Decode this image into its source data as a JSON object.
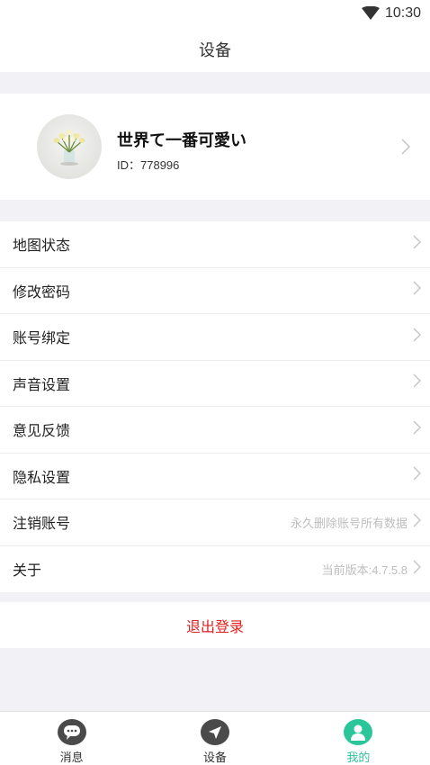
{
  "status_bar": {
    "time": "10:30",
    "wifi_icon": "wifi-icon"
  },
  "header": {
    "title": "设备"
  },
  "profile": {
    "name": "世界て一番可愛い",
    "id_text": "ID：778996",
    "avatar_icon": "flower-vase-avatar"
  },
  "menu": {
    "items": [
      {
        "label": "地图状态",
        "hint": ""
      },
      {
        "label": "修改密码",
        "hint": ""
      },
      {
        "label": "账号绑定",
        "hint": ""
      },
      {
        "label": "声音设置",
        "hint": ""
      },
      {
        "label": "意见反馈",
        "hint": ""
      },
      {
        "label": "隐私设置",
        "hint": ""
      },
      {
        "label": "注销账号",
        "hint": "永久删除账号所有数据"
      },
      {
        "label": "关于",
        "hint": "当前版本:4.7.5.8"
      }
    ]
  },
  "logout": {
    "label": "退出登录"
  },
  "tabs": [
    {
      "label": "消息",
      "icon": "message-icon",
      "active": false
    },
    {
      "label": "设备",
      "icon": "navigation-icon",
      "active": false
    },
    {
      "label": "我的",
      "icon": "user-icon",
      "active": true
    }
  ],
  "colors": {
    "accent": "#2bc59a",
    "danger": "#e02020",
    "tab_icon_inactive": "#4a4a4a",
    "background": "#f2f2f6"
  }
}
